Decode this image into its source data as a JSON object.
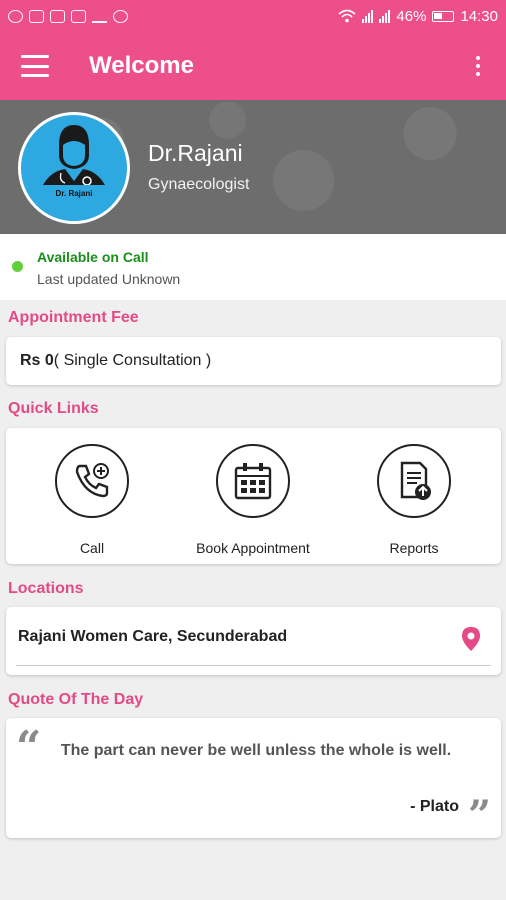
{
  "status_bar": {
    "battery": "46%",
    "time": "14:30",
    "icons": [
      "whatsapp-icon",
      "message-icon",
      "mail-icon",
      "image-icon",
      "download-icon",
      "block-icon",
      "wifi-icon",
      "signal-icon",
      "signal-icon",
      "battery-icon"
    ]
  },
  "app_bar": {
    "title": "Welcome",
    "menu_icon": "hamburger-menu-icon",
    "overflow_icon": "more-vert-icon"
  },
  "doctor": {
    "name": "Dr.Rajani",
    "specialty": "Gynaecologist",
    "avatar_label": "Dr. Rajani"
  },
  "availability": {
    "status": "Available on Call",
    "updated": "Last updated Unknown",
    "status_color": "#5fcf3a"
  },
  "appointment_fee": {
    "title": "Appointment Fee",
    "amount": "Rs 0",
    "note": "( Single Consultation )"
  },
  "quick_links": {
    "title": "Quick Links",
    "items": [
      {
        "label": "Call",
        "icon": "phone-plus-icon"
      },
      {
        "label": "Book Appointment",
        "icon": "calendar-icon"
      },
      {
        "label": "Reports",
        "icon": "report-upload-icon"
      }
    ]
  },
  "locations": {
    "title": "Locations",
    "items": [
      {
        "name": "Rajani Women Care, Secunderabad",
        "icon": "location-pin-icon"
      }
    ]
  },
  "quote": {
    "title": "Quote Of The Day",
    "text": "The part can never be well unless the whole is well.",
    "author": "- Plato"
  },
  "colors": {
    "accent": "#ed4f8a",
    "section_title": "#e34b86",
    "background": "#efefef"
  }
}
